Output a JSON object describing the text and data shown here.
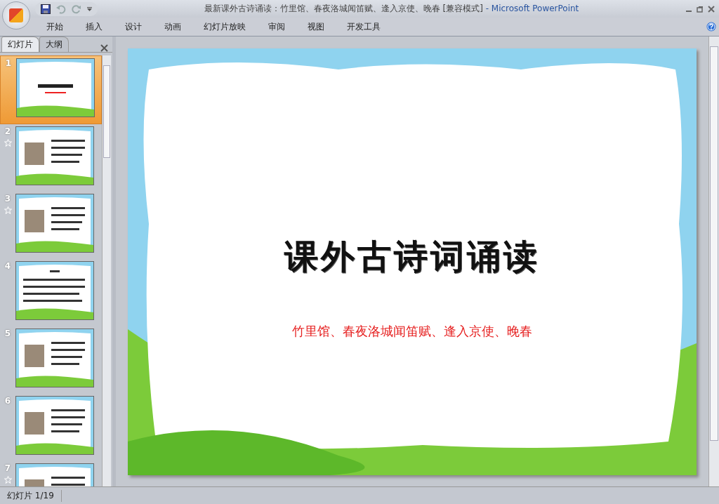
{
  "window": {
    "title": "最新课外古诗诵读：竹里馆、春夜洛城闻笛赋、逢入京使、晚春 [兼容模式]",
    "app": "- Microsoft PowerPoint"
  },
  "ribbon_tabs": [
    {
      "label": "开始",
      "selected": false
    },
    {
      "label": "插入",
      "selected": false
    },
    {
      "label": "设计",
      "selected": false
    },
    {
      "label": "动画",
      "selected": false
    },
    {
      "label": "幻灯片放映",
      "selected": false
    },
    {
      "label": "审阅",
      "selected": false
    },
    {
      "label": "视图",
      "selected": false
    },
    {
      "label": "开发工具",
      "selected": false
    }
  ],
  "pane_tabs": [
    {
      "label": "幻灯片",
      "selected": true
    },
    {
      "label": "大纲",
      "selected": false
    }
  ],
  "slides": [
    {
      "number": "1",
      "selected": true,
      "animated": false,
      "kind": "title"
    },
    {
      "number": "2",
      "selected": false,
      "animated": true,
      "kind": "photo"
    },
    {
      "number": "3",
      "selected": false,
      "animated": true,
      "kind": "photo"
    },
    {
      "number": "4",
      "selected": false,
      "animated": false,
      "kind": "text"
    },
    {
      "number": "5",
      "selected": false,
      "animated": false,
      "kind": "photo"
    },
    {
      "number": "6",
      "selected": false,
      "animated": false,
      "kind": "photo"
    },
    {
      "number": "7",
      "selected": false,
      "animated": true,
      "kind": "photo"
    }
  ],
  "slide": {
    "title": "课外古诗词诵读",
    "subtitle": "竹里馆、春夜洛城闻笛赋、逢入京使、晚春"
  },
  "status_bar": {
    "slide_counter": "幻灯片 1/19"
  }
}
